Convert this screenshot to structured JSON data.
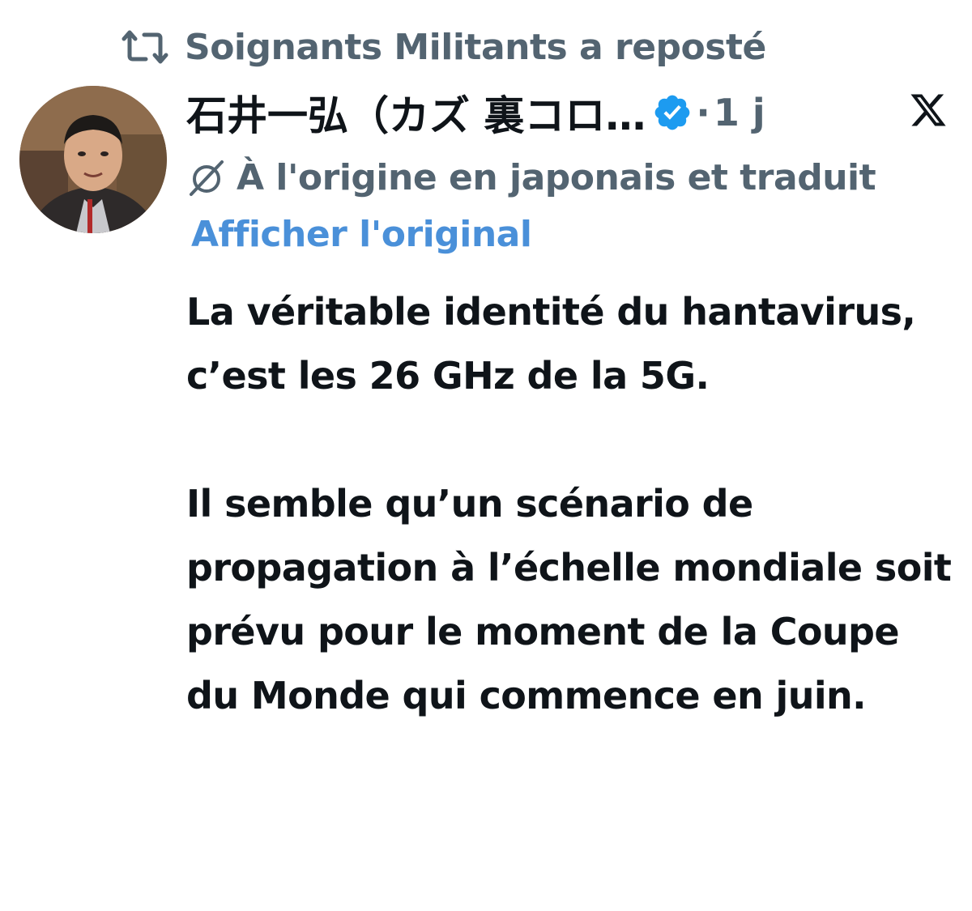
{
  "repost": {
    "icon": "repost-icon",
    "text": "Soignants Militants a reposté"
  },
  "author": {
    "avatar_icon": "avatar",
    "display_name": "石井一弘（カズ 裏コロ…",
    "verified_icon": "verified-badge-icon",
    "verified_color": "#1d9bf0",
    "separator": "·",
    "time": "1 j"
  },
  "platform_logo": "x-logo-icon",
  "translation": {
    "icon": "translate-slashed-icon",
    "notice": "À l'origine en japonais et traduit",
    "show_original": "Afficher l'original",
    "link_color": "#4a90d9"
  },
  "tweet": {
    "paragraphs": [
      "La véritable identité du hantavirus, c’est les 26 GHz de la 5G.",
      "Il semble qu’un scénario de propagation à l’échelle mondiale soit prévu pour le moment de la Coupe du Monde qui commence en juin."
    ]
  }
}
